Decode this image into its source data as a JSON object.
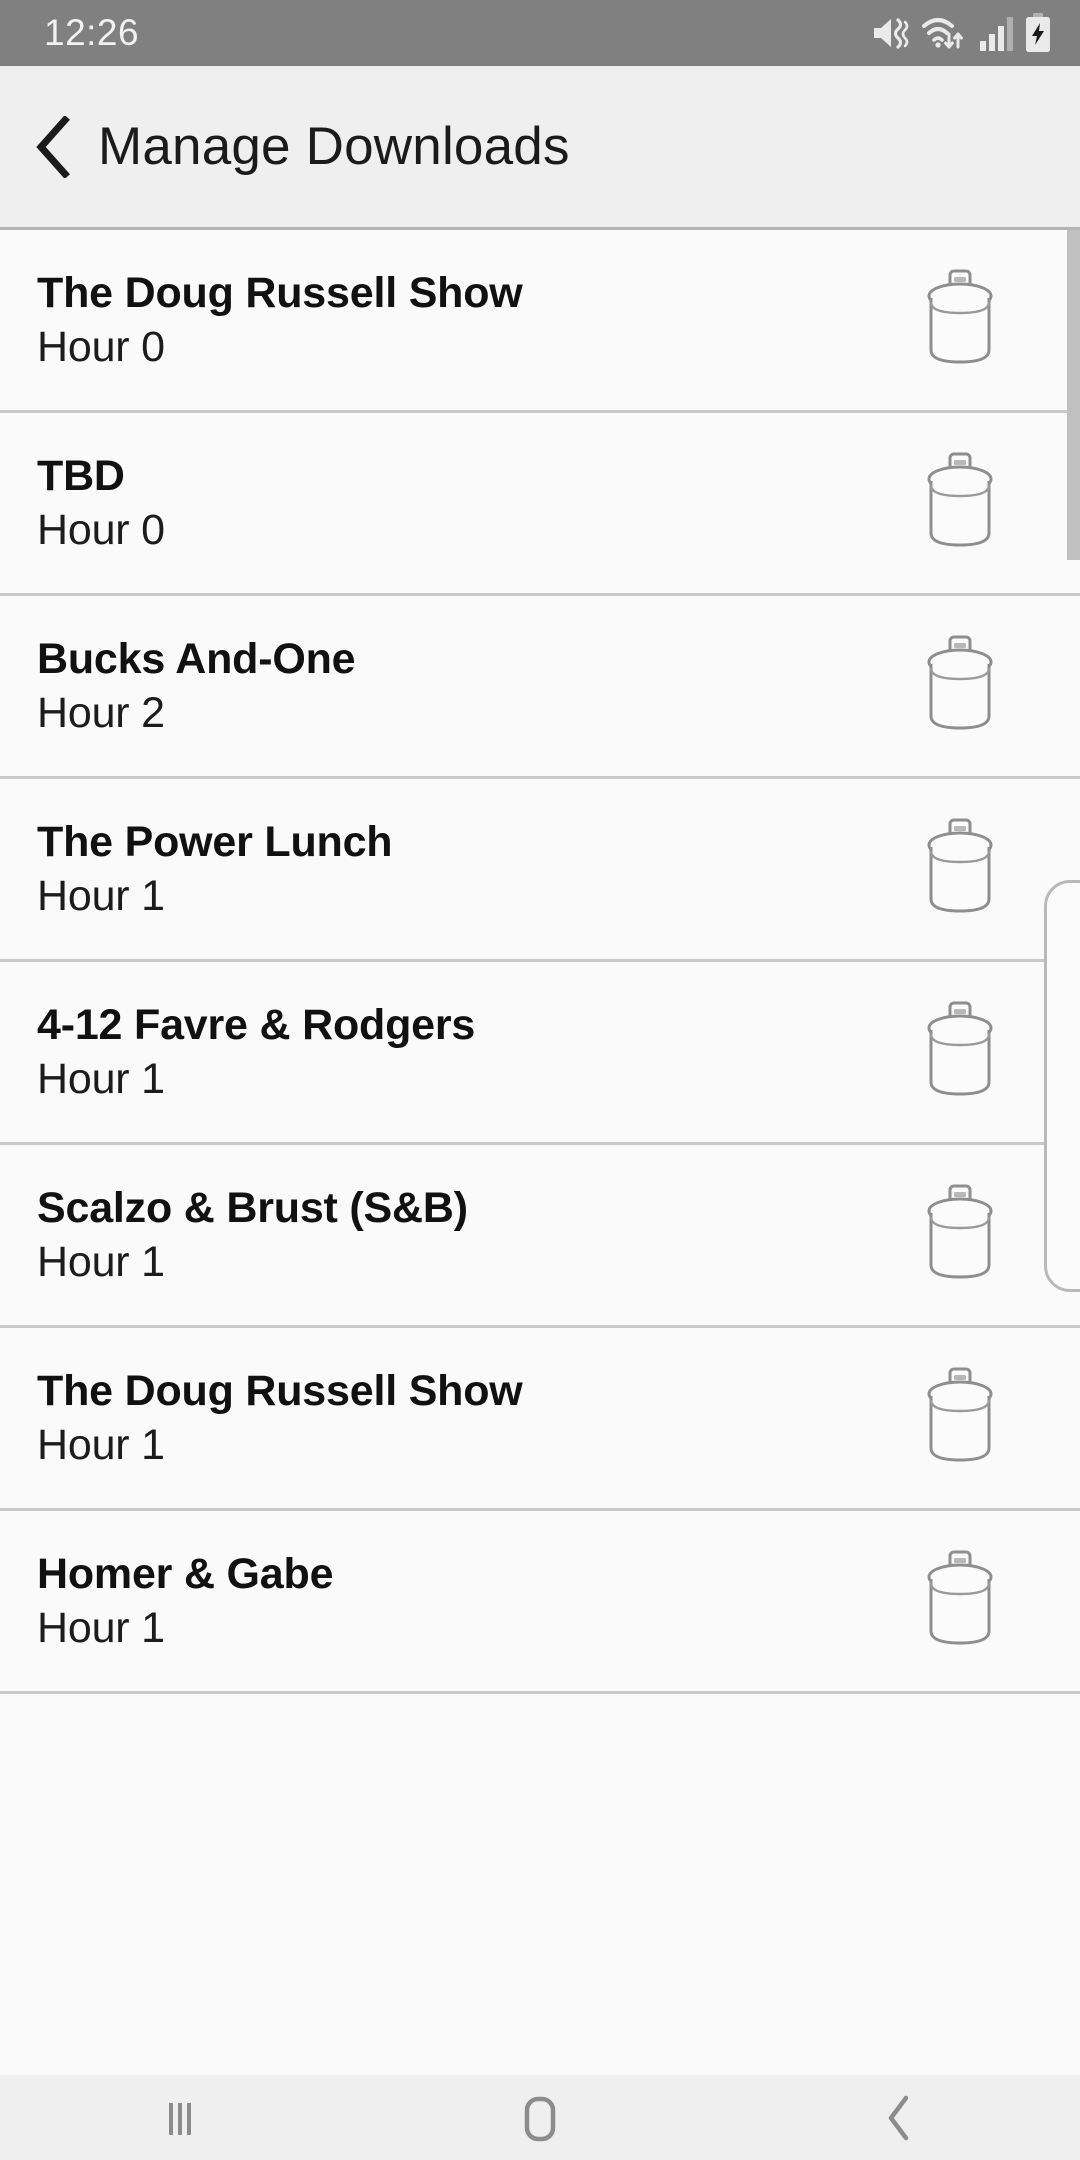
{
  "status_bar": {
    "time": "12:26",
    "icons": [
      {
        "name": "mute-vibrate-icon",
        "label": "Sound muted / vibrate"
      },
      {
        "name": "wifi-icon",
        "label": "Wi-Fi connected with data transfer"
      },
      {
        "name": "cellular-signal-icon",
        "label": "Cellular signal"
      },
      {
        "name": "battery-charging-icon",
        "label": "Battery charging"
      }
    ],
    "background_color": "#808080",
    "text_color": "#f2f2f2"
  },
  "app_bar": {
    "back_icon": "back-chevron-icon",
    "title": "Manage Downloads",
    "background_color": "#efefef",
    "text_color": "#1b1b1b"
  },
  "list": {
    "delete_icon": "trash-icon",
    "row_background": "#fafafa",
    "divider_color": "#c9c9c9",
    "items": [
      {
        "title": "The Doug Russell Show",
        "subtitle": "Hour 0"
      },
      {
        "title": "TBD",
        "subtitle": "Hour 0"
      },
      {
        "title": "Bucks And-One",
        "subtitle": "Hour 2"
      },
      {
        "title": "The Power Lunch",
        "subtitle": "Hour 1"
      },
      {
        "title": "4-12 Favre & Rodgers",
        "subtitle": "Hour 1"
      },
      {
        "title": "Scalzo & Brust (S&B)",
        "subtitle": "Hour 1"
      },
      {
        "title": "The Doug Russell Show",
        "subtitle": "Hour 1"
      },
      {
        "title": "Homer & Gabe",
        "subtitle": "Hour 1"
      }
    ]
  },
  "scrollbar": {
    "name": "vertical-scrollbar",
    "color": "#c0c0c0"
  },
  "nav_bar": {
    "background_color": "#efefef",
    "icon_color": "#8c8c8c",
    "buttons": [
      {
        "name": "recents-button",
        "icon": "recents-icon"
      },
      {
        "name": "home-button",
        "icon": "home-icon"
      },
      {
        "name": "back-button",
        "icon": "back-icon"
      }
    ]
  }
}
